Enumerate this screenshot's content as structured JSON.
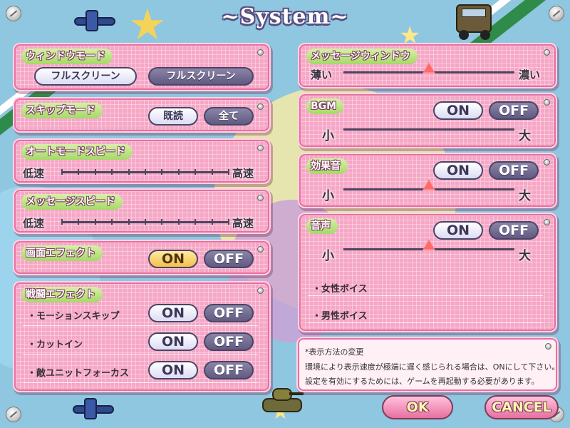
{
  "title": "~System~",
  "window_mode": {
    "label": "ウィンドウモード",
    "options": [
      "フルスクリーン",
      "フルスクリーン"
    ],
    "selected_index": 1
  },
  "skip_mode": {
    "label": "スキップモード",
    "options": [
      "既読",
      "全て"
    ],
    "selected_index": 1
  },
  "auto_speed": {
    "label": "オートモードスピード",
    "min_label": "低速",
    "max_label": "高速"
  },
  "message_speed": {
    "label": "メッセージスピード",
    "min_label": "低速",
    "max_label": "高速"
  },
  "screen_effect": {
    "label": "画面エフェクト",
    "on": "ON",
    "off": "OFF",
    "value": "ON"
  },
  "battle_effect": {
    "label": "戦闘エフェクト",
    "rows": [
      {
        "label": "・モーションスキップ",
        "on": "ON",
        "off": "OFF",
        "value": "OFF"
      },
      {
        "label": "・カットイン",
        "on": "ON",
        "off": "OFF",
        "value": "OFF"
      },
      {
        "label": "・敵ユニットフォーカス",
        "on": "ON",
        "off": "OFF",
        "value": "OFF"
      }
    ]
  },
  "message_window": {
    "label": "メッセージウィンドウ",
    "min_label": "薄い",
    "max_label": "濃い",
    "level": 0.5
  },
  "bgm": {
    "label": "BGM",
    "on": "ON",
    "off": "OFF",
    "value": "OFF",
    "min_label": "小",
    "max_label": "大",
    "level": null
  },
  "sfx": {
    "label": "効果音",
    "on": "ON",
    "off": "OFF",
    "value": "OFF",
    "min_label": "小",
    "max_label": "大",
    "level": 0.5
  },
  "voice": {
    "label": "音声",
    "on": "ON",
    "off": "OFF",
    "value": "OFF",
    "min_label": "小",
    "max_label": "大",
    "level": 0.5,
    "sub_items": [
      "・女性ボイス",
      "・男性ボイス"
    ]
  },
  "info": {
    "heading": "*表示方法の変更",
    "line1": "環境により表示速度が極端に遅く感じられる場合は、ONにして下さい。",
    "line2": "設定を有効にするためには、ゲームを再起動する必要があります。"
  },
  "ok_label": "OK",
  "cancel_label": "CANCEL",
  "colors": {
    "panel": "#f6a7c6",
    "border": "#e86fa0",
    "label_green": "#a6d868",
    "off_button": "#615a82",
    "slider_thumb": "#ff6a6a"
  }
}
